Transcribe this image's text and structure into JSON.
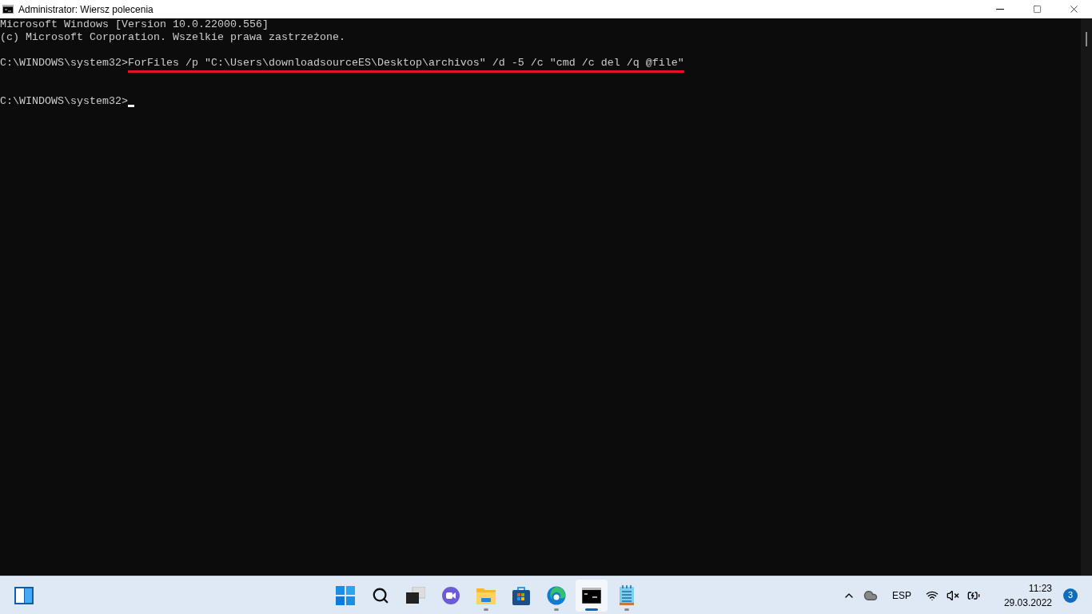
{
  "window": {
    "title": "Administrator: Wiersz polecenia"
  },
  "console": {
    "lines": [
      {
        "kind": "output",
        "text": "Microsoft Windows [Version 10.0.22000.556]"
      },
      {
        "kind": "output",
        "text": "(c) Microsoft Corporation. Wszelkie prawa zastrzeżone."
      },
      {
        "kind": "blank"
      },
      {
        "kind": "command",
        "prompt": "C:\\WINDOWS\\system32>",
        "text": "ForFiles /p \"C:\\Users\\downloadsourceES\\Desktop\\archivos\" /d -5 /c \"cmd /c del /q @file\"",
        "underlined": true,
        "cursor": false
      },
      {
        "kind": "blank"
      },
      {
        "kind": "blank"
      },
      {
        "kind": "command",
        "prompt": "C:\\WINDOWS\\system32>",
        "underlined": false,
        "cursor": true
      }
    ]
  },
  "taskbar": {
    "apps": [
      {
        "kind": "start",
        "running": false,
        "selected": false
      },
      {
        "kind": "search",
        "running": false,
        "selected": false
      },
      {
        "kind": "taskview",
        "running": false,
        "selected": false
      },
      {
        "kind": "chat",
        "running": false,
        "selected": false
      },
      {
        "kind": "folder",
        "running": true,
        "selected": false
      },
      {
        "kind": "store",
        "running": false,
        "selected": false
      },
      {
        "kind": "edge",
        "running": true,
        "selected": false
      },
      {
        "kind": "terminal",
        "running": true,
        "selected": true
      },
      {
        "kind": "notepad",
        "running": true,
        "selected": false
      }
    ],
    "language": "ESP",
    "time": "11:23",
    "date": "29.03.2022",
    "notifications": "3"
  }
}
